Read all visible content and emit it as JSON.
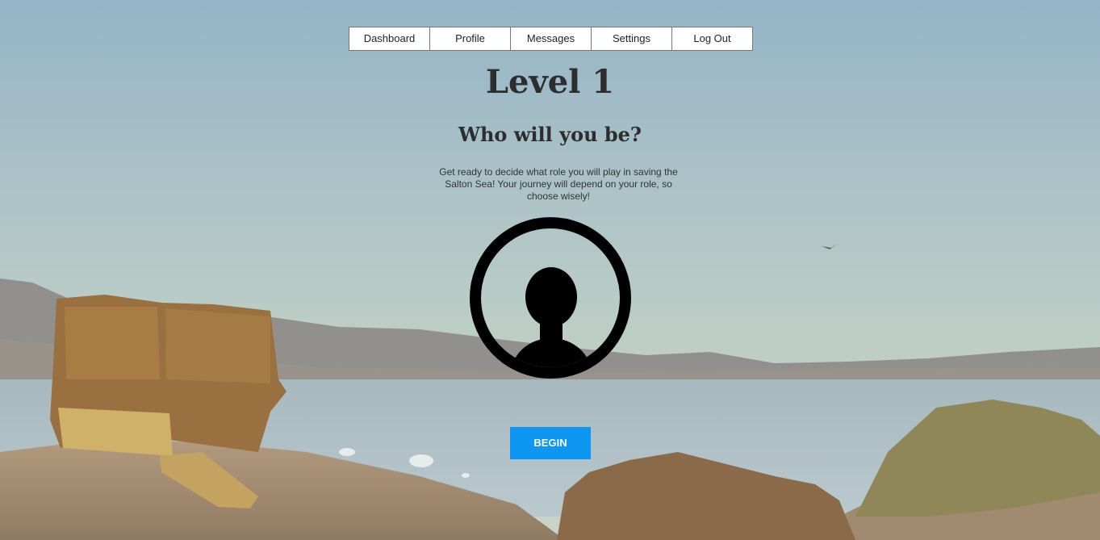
{
  "nav": {
    "items": [
      {
        "label": "Dashboard"
      },
      {
        "label": "Profile"
      },
      {
        "label": "Messages"
      },
      {
        "label": "Settings"
      },
      {
        "label": "Log Out"
      }
    ]
  },
  "main": {
    "title": "Level 1",
    "subtitle": "Who will you be?",
    "description": "Get ready to decide what role you will play in saving the Salton Sea! Your journey will depend on your role, so choose wisely!",
    "avatar_icon": "user-silhouette-icon",
    "begin_label": "BEGIN"
  },
  "colors": {
    "accent": "#0d96f2",
    "heading": "#2d2d2d",
    "sky_top": "#97b6c9",
    "sky_bottom": "#c4d2c9",
    "water": "#a9bcc2"
  }
}
